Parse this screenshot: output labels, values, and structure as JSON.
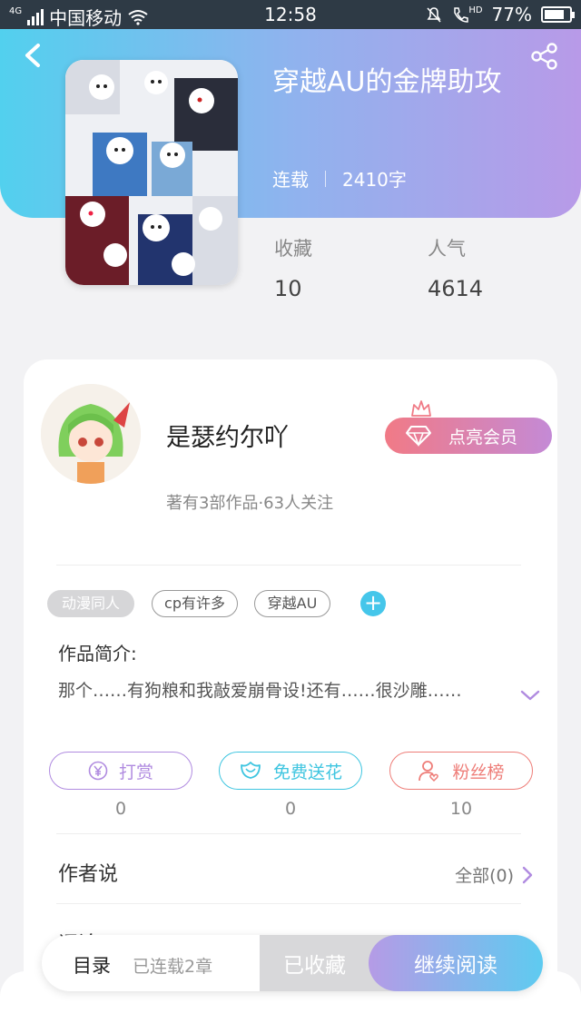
{
  "status_bar": {
    "network": "4G",
    "carrier": "中国移动",
    "time": "12:58",
    "hd": "HD",
    "battery": "77%",
    "battery_level": 0.77
  },
  "book": {
    "title": "穿越AU的金牌助攻",
    "status": "连载",
    "word_count": "2410字",
    "favorites_label": "收藏",
    "favorites_value": "10",
    "popularity_label": "人气",
    "popularity_value": "4614"
  },
  "author": {
    "name": "是瑟约尔吖",
    "sub": "著有3部作品·63人关注",
    "vip_button": "点亮会员"
  },
  "tags": [
    "动漫同人",
    "cp有许多",
    "穿越AU"
  ],
  "tag_add": "+",
  "intro": {
    "label": "作品简介:",
    "text": "那个……有狗粮和我敲爱崩骨设!还有……很沙雕……"
  },
  "actions": {
    "tip_label": "打赏",
    "tip_count": "0",
    "flower_label": "免费送花",
    "flower_count": "0",
    "fans_label": "粉丝榜",
    "fans_count": "10",
    "colors": {
      "tip": "#b08be0",
      "flower": "#3ec5e0",
      "fans": "#ee7d78"
    }
  },
  "author_says": {
    "label": "作者说",
    "more": "全部(0)"
  },
  "comments": {
    "label": "评论"
  },
  "bottom_bar": {
    "toc": "目录",
    "chapters": "已连载2章",
    "favorited": "已收藏",
    "read": "继续阅读"
  },
  "colors": {
    "hero_start": "#52d0ee",
    "hero_end": "#b89ae8",
    "accent_blue": "#45c6ea"
  }
}
